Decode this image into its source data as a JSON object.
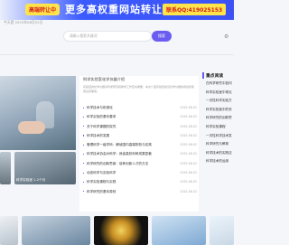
{
  "banner": {
    "tag": "高端转让中",
    "slogan": "更多高权重网站转让",
    "qq": "联系QQ:419025153"
  },
  "header": {
    "date": "今天是 2025年08月02日"
  },
  "search": {
    "placeholder": "请输入搜索关键词",
    "button": "搜索"
  },
  "hero": {
    "title": "科学实验室化学仪器介绍",
    "desc": "实验室的化学仪器对科学研究和教学工作至关重要，本文介绍实验室常见化学仪器的用途和使用注意事项。"
  },
  "news": [
    {
      "title": "科学技术与机械化",
      "date": "2025-08-02"
    },
    {
      "title": "科学实验的基本要求",
      "date": "2025-08-02"
    },
    {
      "title": "关于科学课题的探究",
      "date": "2025-08-02"
    },
    {
      "title": "科学技术的发展",
      "date": "2025-08-02"
    },
    {
      "title": "管理科学一级学科：解读国内高端院校与实践",
      "date": "2025-08-02"
    },
    {
      "title": "科学技术协会对科学：我省高校科研成果显著",
      "date": "2025-08-02"
    },
    {
      "title": "科学研究的创新思维：培养创新人才的方法",
      "date": "2025-08-02"
    },
    {
      "title": "动态科学与实验科学",
      "date": "2025-08-02"
    },
    {
      "title": "科学实验课程与实践",
      "date": "2025-08-02"
    },
    {
      "title": "科学研究的基本原则",
      "date": "2025-08-02"
    }
  ],
  "hero_caption": "科学实验室 1-2个月",
  "sidebar": {
    "heading": "重点阅读",
    "items": [
      "在科学研究中如何",
      "科学实验室中常见",
      "一次性科学实验方",
      "科学实验室中的安",
      "科学研究的创新思",
      "科学实验课程",
      "一次性科学技术发",
      "科学研究与教育",
      "科学技术的实践应",
      "科学技术的运用"
    ]
  },
  "icons": {
    "weixin": "weixin-icon",
    "accent": "#6a5cf0",
    "banner_blue": "#3b5bff",
    "banner_yellow": "#ffe34a"
  }
}
